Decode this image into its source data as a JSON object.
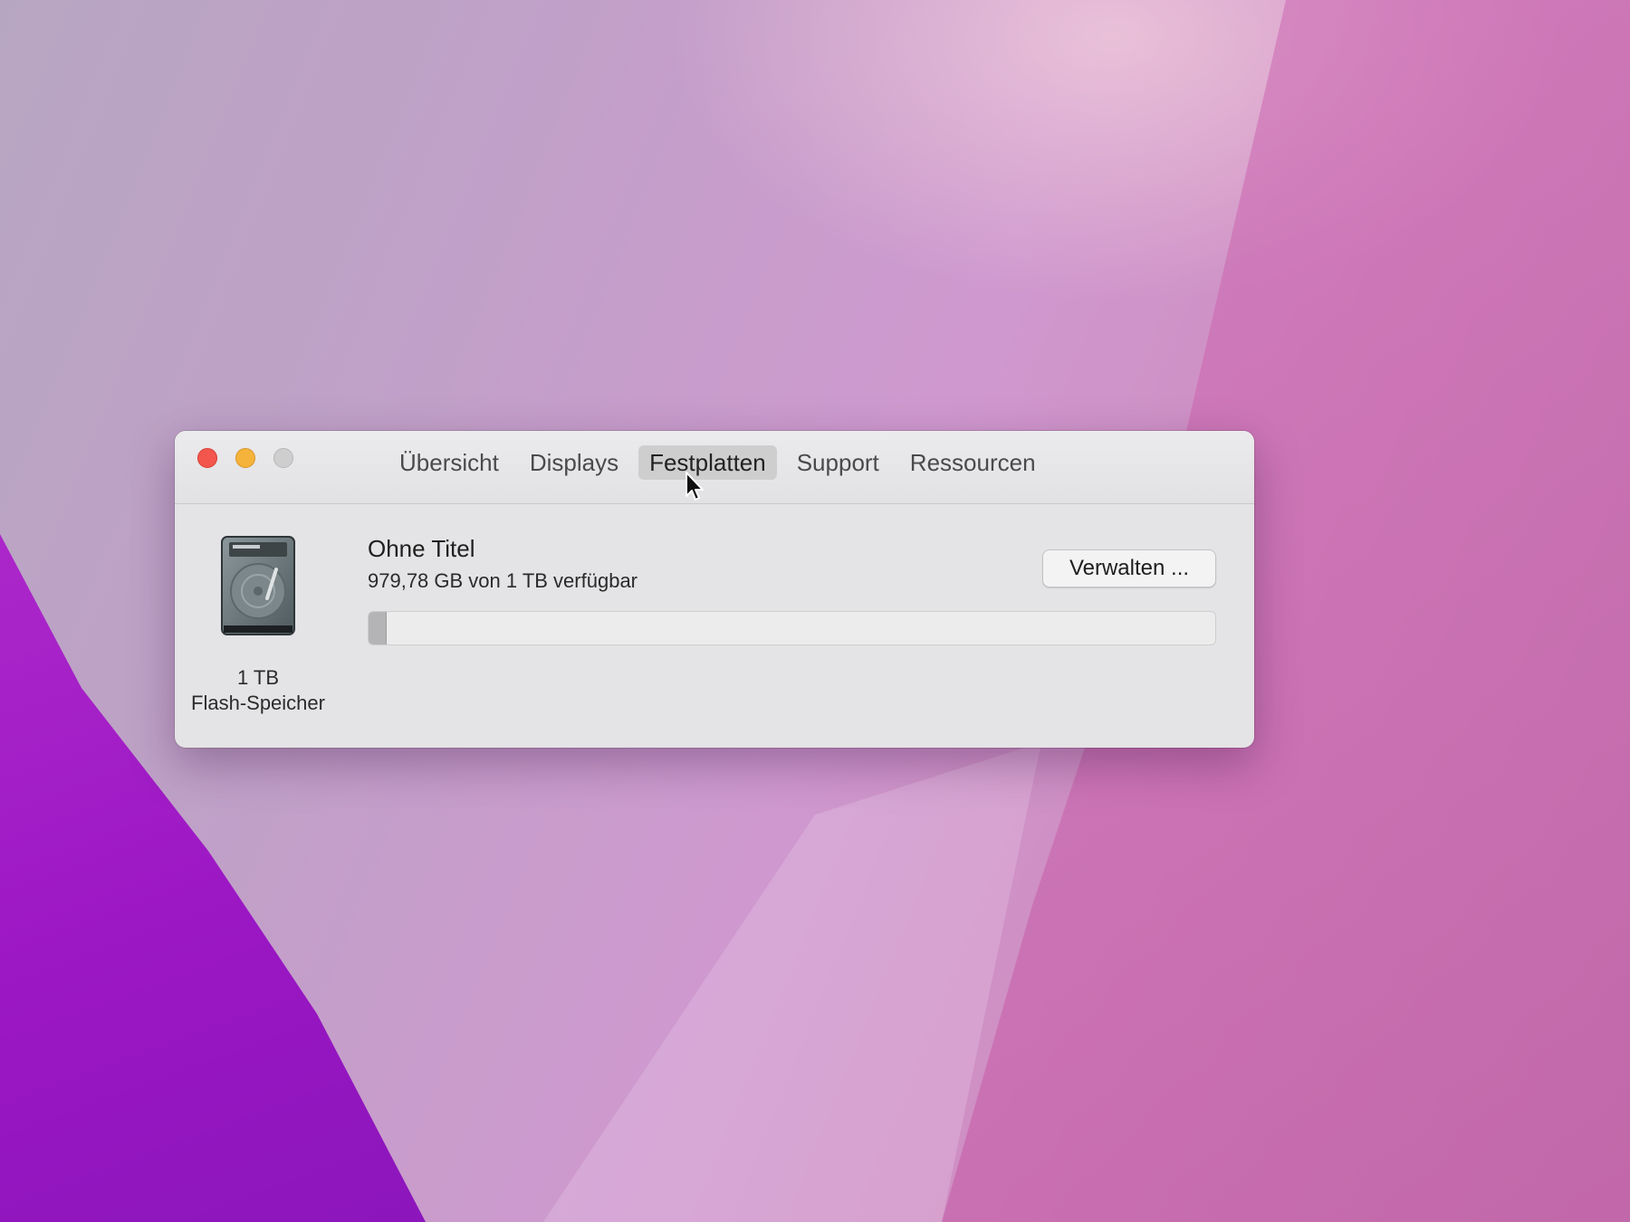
{
  "window": {
    "tabs": [
      {
        "label": "Übersicht",
        "active": false
      },
      {
        "label": "Displays",
        "active": false
      },
      {
        "label": "Festplatten",
        "active": true
      },
      {
        "label": "Support",
        "active": false
      },
      {
        "label": "Ressourcen",
        "active": false
      }
    ]
  },
  "drive": {
    "icon": "hard-drive-icon",
    "capacity_label": "1 TB",
    "type_label": "Flash-Speicher"
  },
  "volume": {
    "name": "Ohne Titel",
    "space_text": "979,78 GB von 1 TB verfügbar",
    "used_fraction": 0.02,
    "manage_button": "Verwalten ..."
  },
  "colors": {
    "close": "#f2564c",
    "minimize": "#f5b33b",
    "zoom_disabled": "#cfcecf"
  }
}
